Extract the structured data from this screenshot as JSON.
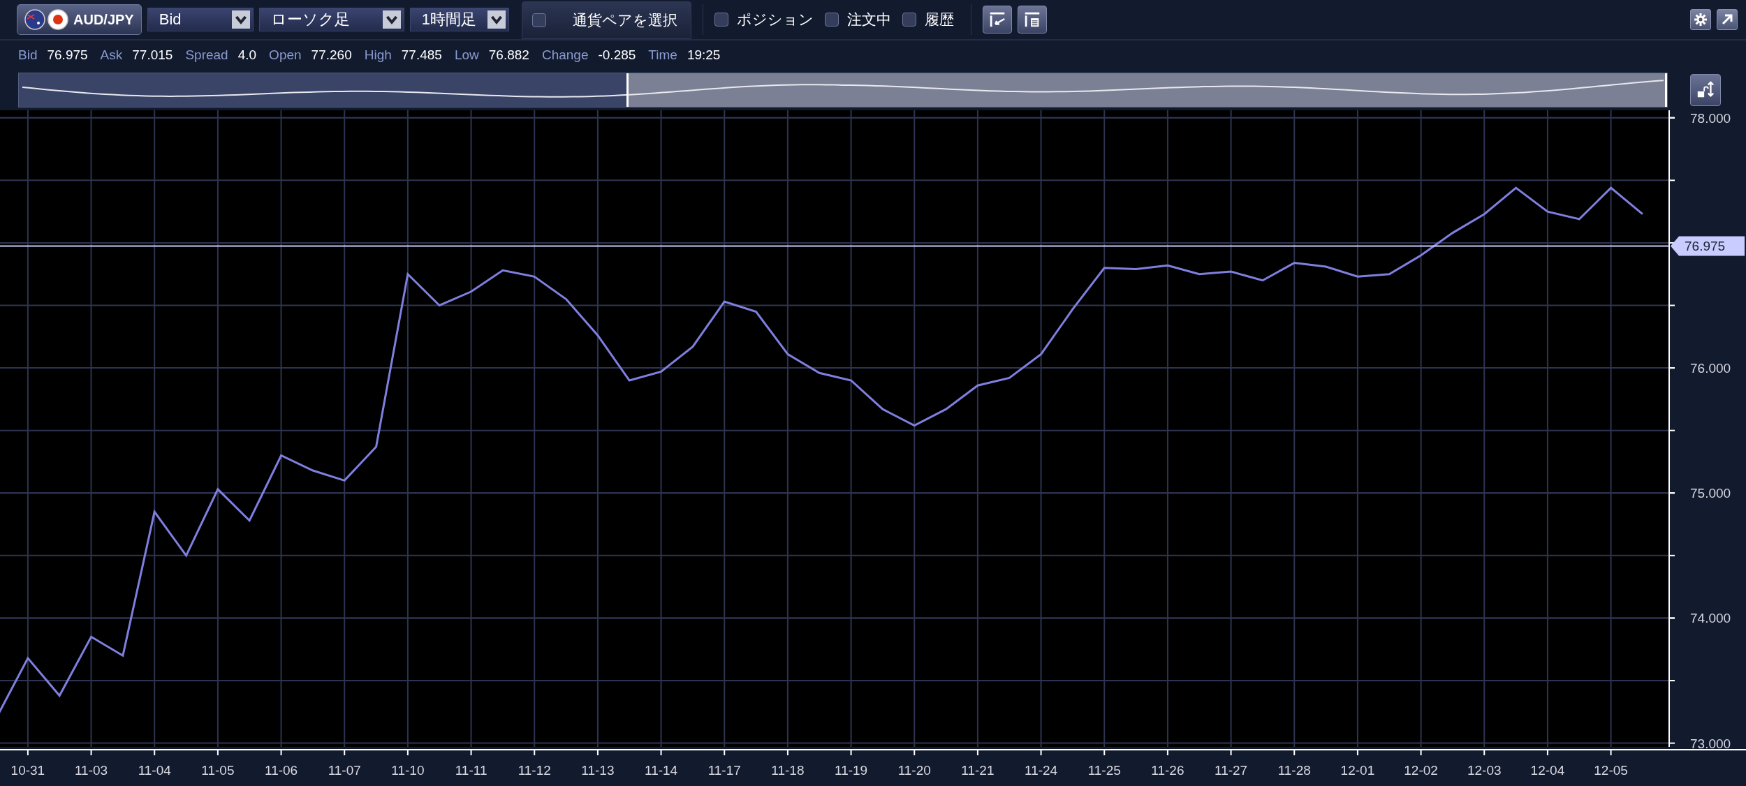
{
  "toolbar": {
    "pair": {
      "label": "AUD/JPY"
    },
    "dropdowns": [
      {
        "value": "Bid"
      },
      {
        "value": "ローソク足"
      },
      {
        "value": "1時間足"
      }
    ],
    "select_pair": {
      "label": "通貨ペアを選択",
      "checked": false
    },
    "checkboxes": [
      {
        "label": "ポジション",
        "checked": false
      },
      {
        "label": "注文中",
        "checked": false
      },
      {
        "label": "履歴",
        "checked": false
      }
    ]
  },
  "info": [
    {
      "label": "Bid",
      "value": "76.975"
    },
    {
      "label": "Ask",
      "value": "77.015"
    },
    {
      "label": "Spread",
      "value": "4.0"
    },
    {
      "label": "Open",
      "value": "77.260"
    },
    {
      "label": "High",
      "value": "77.485"
    },
    {
      "label": "Low",
      "value": "76.882"
    },
    {
      "label": "Change",
      "value": "-0.285"
    },
    {
      "label": "Time",
      "value": "19:25"
    }
  ],
  "chart": {
    "chart_data": {
      "type": "line",
      "categories": [
        null,
        "10-31",
        null,
        "11-03",
        null,
        "11-04",
        null,
        "11-05",
        null,
        "11-06",
        null,
        "11-07",
        null,
        "11-10",
        null,
        "11-11",
        null,
        "11-12",
        null,
        "11-13",
        null,
        "11-14",
        null,
        "11-17",
        null,
        "11-18",
        null,
        "11-19",
        null,
        "11-20",
        null,
        "11-21",
        null,
        "11-24",
        null,
        "11-25",
        null,
        "11-26",
        null,
        "11-27",
        null,
        "11-28",
        null,
        "12-01",
        null,
        "12-02",
        null,
        "12-03",
        null,
        "12-04",
        null,
        "12-05",
        null
      ],
      "series": [
        {
          "color": "#7f7fe0",
          "values": [
            73.2,
            73.68,
            73.38,
            73.85,
            73.7,
            74.85,
            74.5,
            75.03,
            74.78,
            75.3,
            75.18,
            75.1,
            75.37,
            76.75,
            76.5,
            76.61,
            76.78,
            76.73,
            76.55,
            76.26,
            75.9,
            75.97,
            76.17,
            76.53,
            76.45,
            76.11,
            75.96,
            75.9,
            75.67,
            75.54,
            75.67,
            75.86,
            75.92,
            76.11,
            76.47,
            76.8,
            76.79,
            76.82,
            76.75,
            76.77,
            76.7,
            76.84,
            76.81,
            76.73,
            76.75,
            76.9,
            77.08,
            77.23,
            77.44,
            77.25,
            77.19,
            77.44,
            77.23
          ]
        }
      ],
      "ylim": [
        72.97,
        78.06
      ],
      "grid": true,
      "yticks": [
        {
          "value": 73,
          "label": "73.000"
        },
        {
          "value": 74,
          "label": "74.000"
        },
        {
          "value": 75,
          "label": "75.000"
        },
        {
          "value": 76,
          "label": "76.000"
        },
        {
          "value": 78,
          "label": "78.000"
        }
      ],
      "ref_lines": [
        {
          "axis": "y",
          "value": 76.975,
          "label": "76.975"
        }
      ]
    }
  }
}
